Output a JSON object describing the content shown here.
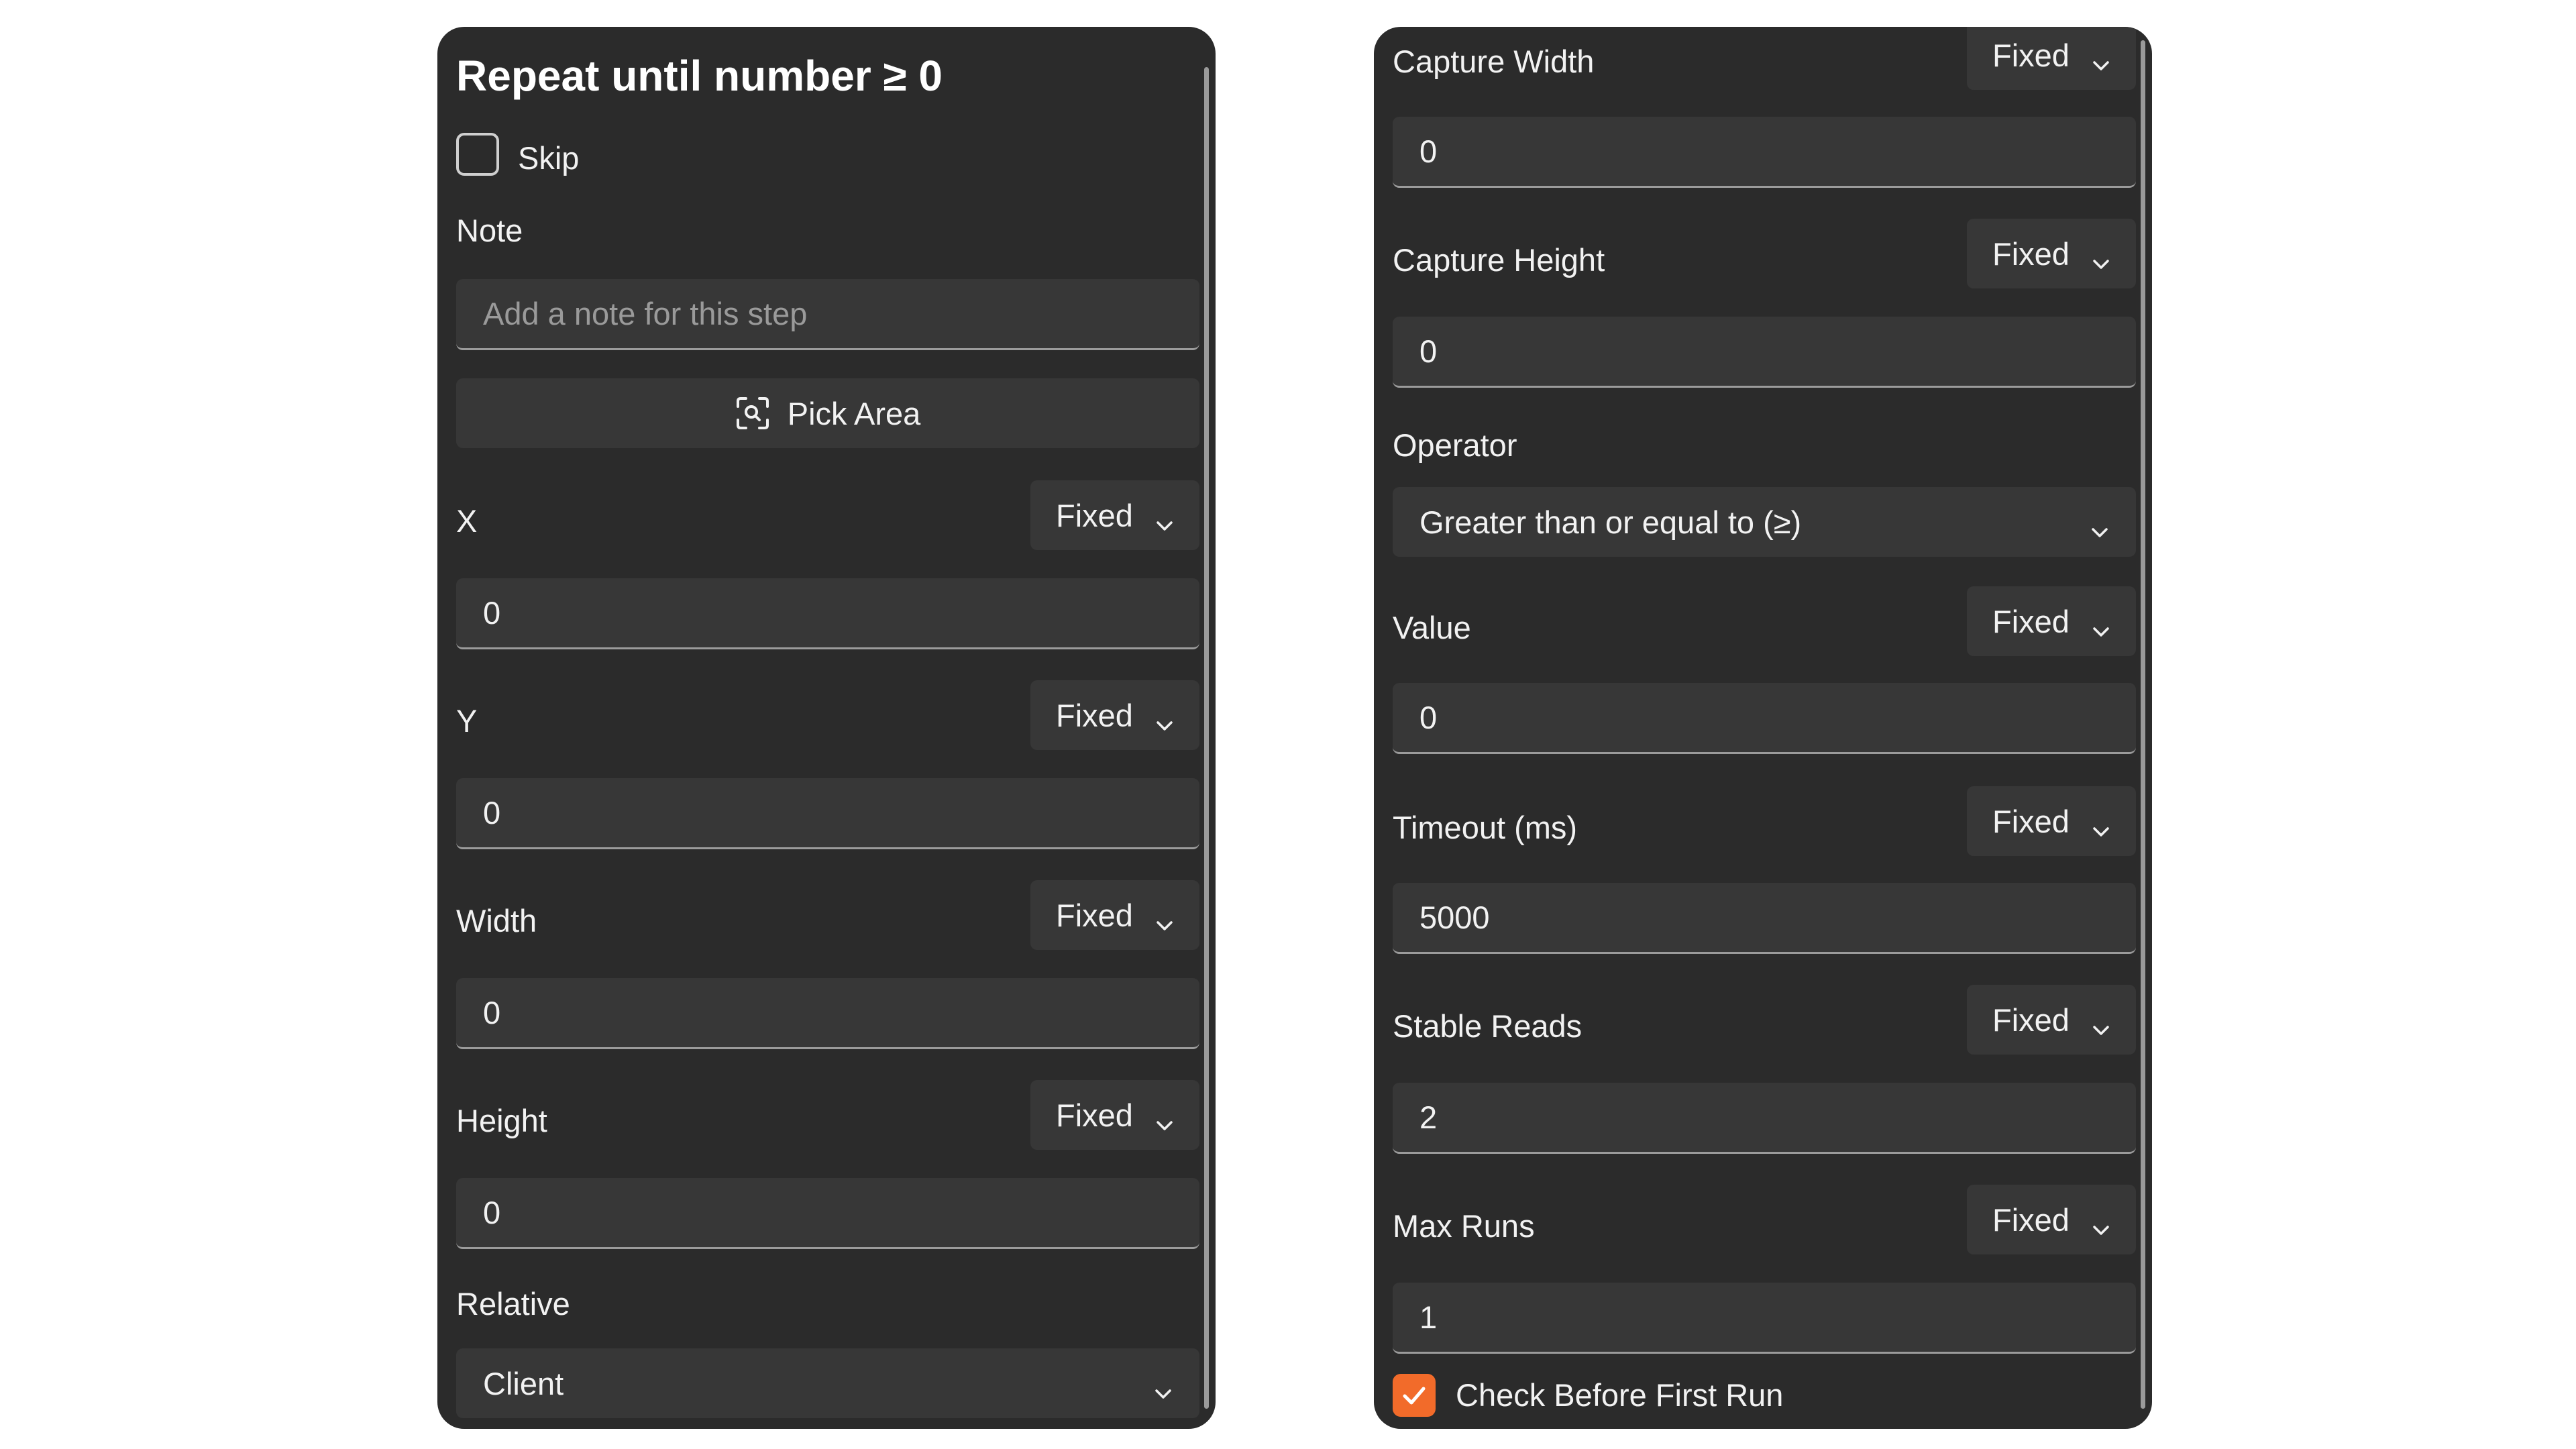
{
  "left_panel": {
    "title": "Repeat until number ≥ 0",
    "skip_label": "Skip",
    "note_label": "Note",
    "note_placeholder": "Add a note for this step",
    "pick_area_label": "Pick Area",
    "fields": [
      {
        "label": "X",
        "mode": "Fixed",
        "value": "0"
      },
      {
        "label": "Y",
        "mode": "Fixed",
        "value": "0"
      },
      {
        "label": "Width",
        "mode": "Fixed",
        "value": "0"
      },
      {
        "label": "Height",
        "mode": "Fixed",
        "value": "0"
      }
    ],
    "relative_label": "Relative",
    "relative_value": "Client"
  },
  "right_panel": {
    "capture_width": {
      "label": "Capture Width",
      "mode": "Fixed",
      "value": "0"
    },
    "capture_height": {
      "label": "Capture Height",
      "mode": "Fixed",
      "value": "0"
    },
    "operator_label": "Operator",
    "operator_value": "Greater than or equal to (≥)",
    "value_field": {
      "label": "Value",
      "mode": "Fixed",
      "value": "0"
    },
    "timeout": {
      "label": "Timeout (ms)",
      "mode": "Fixed",
      "value": "5000"
    },
    "stable_reads": {
      "label": "Stable Reads",
      "mode": "Fixed",
      "value": "2"
    },
    "max_runs": {
      "label": "Max Runs",
      "mode": "Fixed",
      "value": "1"
    },
    "check_before_first_run_label": "Check Before First Run",
    "check_before_first_run_checked": true
  },
  "colors": {
    "panel_bg": "#2b2b2b",
    "input_bg": "#373737",
    "accent": "#f26b2a",
    "text": "#f2f2f2",
    "placeholder": "#9a9a9a"
  }
}
